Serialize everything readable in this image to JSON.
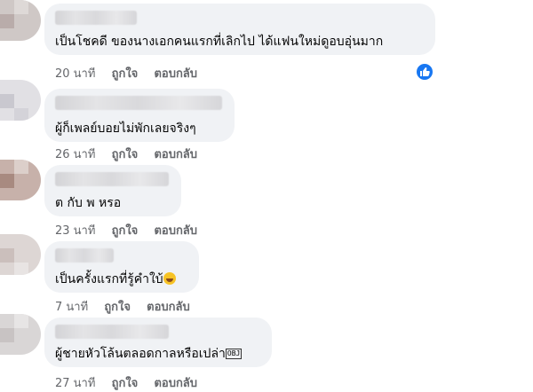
{
  "colors": {
    "bubble": "#f0f2f5",
    "meta": "#65676b",
    "like_blue": "#1877f2"
  },
  "comments": [
    {
      "text": "เป็นโชคดี ของนางเอกคนแรกที่เลิกไป ได้แฟนใหม่ดูอบอุ่นมาก",
      "time": "20 นาที",
      "like_label": "ถูกใจ",
      "reply_label": "ตอบกลับ",
      "reaction_icon": "thumbs-up-icon"
    },
    {
      "text": "ผู้ก็เพลย์บอยไม่พักเลยจริงๆ",
      "time": "26 นาที",
      "like_label": "ถูกใจ",
      "reply_label": "ตอบกลับ"
    },
    {
      "text": "ต กับ พ หรอ",
      "time": "23 นาที",
      "like_label": "ถูกใจ",
      "reply_label": "ตอบกลับ"
    },
    {
      "text": "เป็นครั้งแรกที่รู้คำใบ้",
      "emoji_icon": "laughing-emoji-icon",
      "time": "7 นาที",
      "like_label": "ถูกใจ",
      "reply_label": "ตอบกลับ"
    },
    {
      "text": "ผู้ชายหัวโล้นตลอดกาลหรือเปล่า",
      "suffix_glyph": "OBJ",
      "time": "27 นาที",
      "like_label": "ถูกใจ",
      "reply_label": "ตอบกลับ"
    }
  ]
}
